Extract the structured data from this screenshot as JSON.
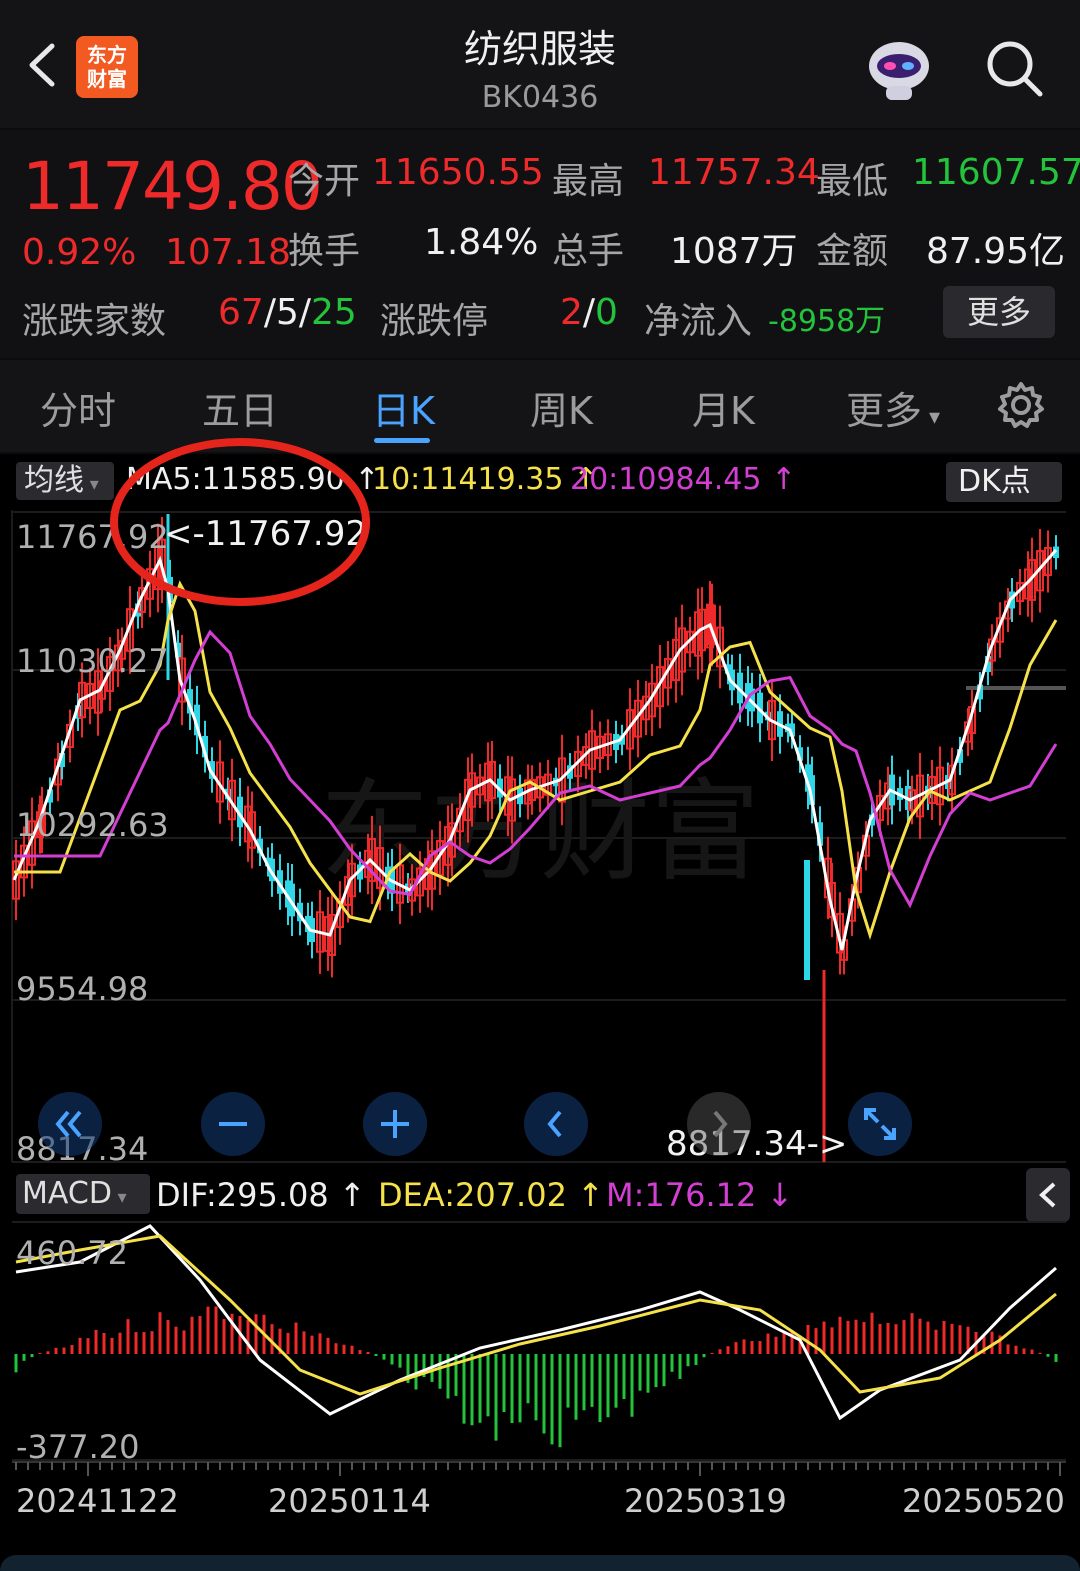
{
  "header": {
    "logo_text_line1": "东方",
    "logo_text_line2": "财富",
    "title": "纺织服装",
    "code": "BK0436"
  },
  "quote": {
    "price": "11749.80",
    "change_pct": "0.92%",
    "change": "107.18",
    "open_label": "今开",
    "open": "11650.55",
    "high_label": "最高",
    "high": "11757.34",
    "low_label": "最低",
    "low": "11607.57",
    "turnover_label": "换手",
    "turnover": "1.84%",
    "volume_label": "总手",
    "volume": "1087万",
    "amount_label": "金额",
    "amount": "87.95亿",
    "breadth_label": "涨跌家数",
    "breadth_up": "67",
    "breadth_flat": "5",
    "breadth_down": "25",
    "limit_label": "涨跌停",
    "limit_up": "2",
    "limit_down": "0",
    "inflow_label": "净流入",
    "inflow": "-8958万",
    "more_button": "更多"
  },
  "tabs": [
    {
      "label": "分时"
    },
    {
      "label": "五日"
    },
    {
      "label": "日K"
    },
    {
      "label": "周K"
    },
    {
      "label": "月K"
    },
    {
      "label": "更多"
    }
  ],
  "active_tab": "日K",
  "kline": {
    "ma_button": "均线",
    "ma5": "MA5:11585.90",
    "ma10": "10:11419.35",
    "ma20": "20:10984.45",
    "dk_button": "DK点",
    "y_labels": [
      "11767.92",
      "11030.27",
      "10292.63",
      "9554.98",
      "8817.34"
    ],
    "high_annotation": "<-11767.92",
    "low_annotation": "8817.34->",
    "watermark": "东方财富"
  },
  "macd": {
    "button": "MACD",
    "dif": "DIF:295.08",
    "dea": "DEA:207.02",
    "m": "M:176.12",
    "y_labels": [
      "460.72",
      "-377.20"
    ]
  },
  "x_labels": [
    "20241122",
    "20250114",
    "20250319",
    "20250520"
  ],
  "colors": {
    "up": "#ee2a2a",
    "down": "#23c33b",
    "accent": "#4aa3ff",
    "ma5": "#ffffff",
    "ma10": "#f5e14a",
    "ma20": "#d23fd2",
    "candle_down": "#2fd6e6"
  },
  "chart_data": {
    "type": "candlestick",
    "title": "",
    "ylim": [
      8817.34,
      11767.92
    ],
    "x_tick_labels": [
      "20241122",
      "20250114",
      "20250319",
      "20250520"
    ],
    "series": [
      {
        "name": "MA5",
        "last": 11585.9
      },
      {
        "name": "MA10",
        "last": 11419.35
      },
      {
        "name": "MA20",
        "last": 10984.45
      }
    ],
    "macd": {
      "ylim": [
        -377.2,
        460.72
      ],
      "DIF": 295.08,
      "DEA": 207.02,
      "M": 176.12
    }
  }
}
